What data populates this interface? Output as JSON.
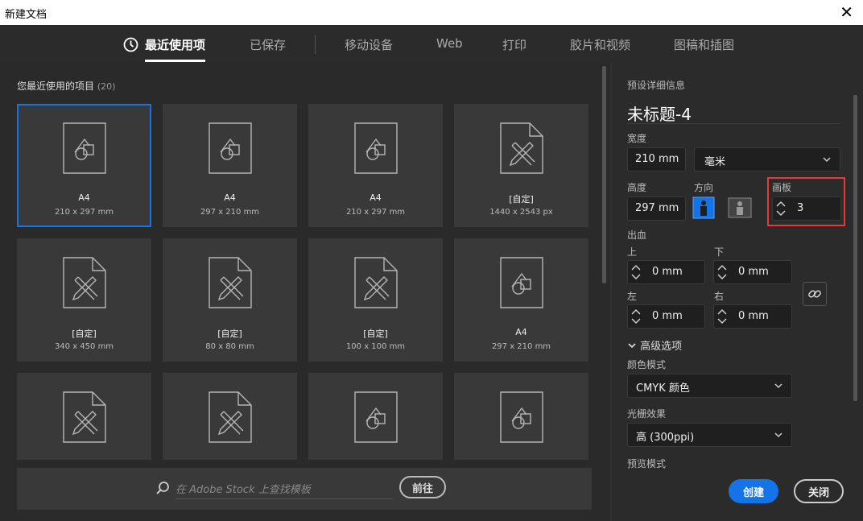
{
  "window": {
    "title": "新建文档",
    "close_glyph": "✕"
  },
  "tabs": [
    {
      "label": "最近使用项",
      "active": true,
      "icon": "clock-icon"
    },
    {
      "label": "已保存"
    },
    {
      "label": "移动设备"
    },
    {
      "label": "Web"
    },
    {
      "label": "打印"
    },
    {
      "label": "胶片和视频"
    },
    {
      "label": "图稿和插图"
    }
  ],
  "recent": {
    "heading": "您最近使用的项目",
    "count": "(20)",
    "items": [
      {
        "name": "A4",
        "size": "210 x 297 mm",
        "icon": "shape-doc-icon",
        "selected": true
      },
      {
        "name": "A4",
        "size": "297 x 210 mm",
        "icon": "shape-doc-icon"
      },
      {
        "name": "A4",
        "size": "210 x 297 mm",
        "icon": "shape-doc-icon"
      },
      {
        "name": "[自定]",
        "size": "1440 x 2543 px",
        "icon": "custom-doc-icon"
      },
      {
        "name": "[自定]",
        "size": "340 x 450 mm",
        "icon": "custom-doc-icon"
      },
      {
        "name": "[自定]",
        "size": "80 x 80 mm",
        "icon": "custom-doc-icon"
      },
      {
        "name": "[自定]",
        "size": "100 x 100 mm",
        "icon": "custom-doc-icon"
      },
      {
        "name": "A4",
        "size": "297 x 210 mm",
        "icon": "shape-doc-icon"
      },
      {
        "name": "",
        "size": "",
        "icon": "custom-doc-icon"
      },
      {
        "name": "",
        "size": "",
        "icon": "custom-doc-icon"
      },
      {
        "name": "",
        "size": "",
        "icon": "shape-doc-icon"
      },
      {
        "name": "",
        "size": "",
        "icon": "shape-doc-icon"
      }
    ]
  },
  "stock": {
    "placeholder": "在 Adobe Stock 上查找模板",
    "go_label": "前往"
  },
  "details": {
    "section_label": "预设详细信息",
    "doc_title": "未标题-4",
    "width_label": "宽度",
    "width_value": "210 mm",
    "unit_value": "毫米",
    "height_label": "高度",
    "height_value": "297 mm",
    "orientation_label": "方向",
    "artboard_label": "画板",
    "artboard_value": "3",
    "bleed_label": "出血",
    "bleed_top_label": "上",
    "bleed_top_value": "0 mm",
    "bleed_bottom_label": "下",
    "bleed_bottom_value": "0 mm",
    "bleed_left_label": "左",
    "bleed_left_value": "0 mm",
    "bleed_right_label": "右",
    "bleed_right_value": "0 mm",
    "advanced_label": "高级选项",
    "color_mode_label": "颜色模式",
    "color_mode_value": "CMYK 颜色",
    "raster_label": "光栅效果",
    "raster_value": "高 (300ppi)",
    "preview_mode_label": "预览模式",
    "create_label": "创建",
    "close_label": "关闭"
  },
  "colors": {
    "accent": "#1473e6",
    "highlight": "#e63a3a",
    "background": "#2a2a2a"
  }
}
